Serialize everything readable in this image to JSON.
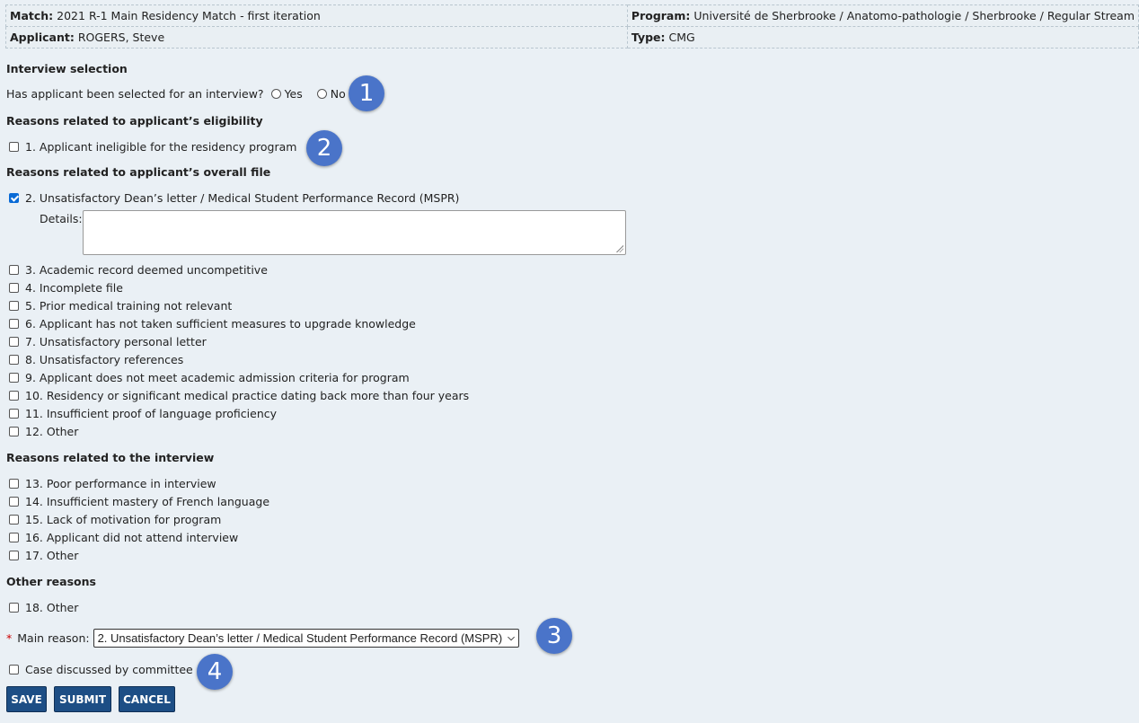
{
  "header": {
    "match_label": "Match:",
    "match_value": "2021 R-1 Main Residency Match - first iteration",
    "program_label": "Program:",
    "program_value": "Université de Sherbrooke / Anatomo-pathologie / Sherbrooke / Regular Stream",
    "applicant_label": "Applicant:",
    "applicant_value": "ROGERS, Steve",
    "type_label": "Type:",
    "type_value": "CMG"
  },
  "interview_selection": {
    "title": "Interview selection",
    "question": "Has applicant been selected for an interview?",
    "yes": "Yes",
    "no": "No"
  },
  "eligibility": {
    "title": "Reasons related to applicant’s eligibility",
    "items": [
      {
        "label": "1. Applicant ineligible for the residency program",
        "checked": false
      }
    ]
  },
  "overall_file": {
    "title": "Reasons related to applicant’s overall file",
    "items": [
      {
        "label": "2. Unsatisfactory Dean’s letter / Medical Student Performance Record (MSPR)",
        "checked": true
      },
      {
        "label": "3. Academic record deemed uncompetitive",
        "checked": false
      },
      {
        "label": "4. Incomplete file",
        "checked": false
      },
      {
        "label": "5. Prior medical training not relevant",
        "checked": false
      },
      {
        "label": "6. Applicant has not taken sufficient measures to upgrade knowledge",
        "checked": false
      },
      {
        "label": "7. Unsatisfactory personal letter",
        "checked": false
      },
      {
        "label": "8. Unsatisfactory references",
        "checked": false
      },
      {
        "label": "9. Applicant does not meet academic admission criteria for program",
        "checked": false
      },
      {
        "label": "10. Residency or significant medical practice dating back more than four years",
        "checked": false
      },
      {
        "label": "11. Insufficient proof of language proficiency",
        "checked": false
      },
      {
        "label": "12. Other",
        "checked": false
      }
    ],
    "details_label": "Details:",
    "details_value": ""
  },
  "interview": {
    "title": "Reasons related to the interview",
    "items": [
      {
        "label": "13. Poor performance in interview",
        "checked": false
      },
      {
        "label": "14. Insufficient mastery of French language",
        "checked": false
      },
      {
        "label": "15. Lack of motivation for program",
        "checked": false
      },
      {
        "label": "16. Applicant did not attend interview",
        "checked": false
      },
      {
        "label": "17. Other",
        "checked": false
      }
    ]
  },
  "other": {
    "title": "Other reasons",
    "items": [
      {
        "label": "18. Other",
        "checked": false
      }
    ]
  },
  "main_reason": {
    "required_mark": "*",
    "label": "Main reason:",
    "selected": "2. Unsatisfactory Dean’s letter / Medical Student Performance Record (MSPR)"
  },
  "committee": {
    "label": "Case discussed by committee",
    "checked": false
  },
  "buttons": {
    "save": "SAVE",
    "submit": "SUBMIT",
    "cancel": "CANCEL"
  },
  "badges": [
    "1",
    "2",
    "3",
    "4"
  ],
  "colors": {
    "badge": "#4a74c9",
    "button": "#1d4e85",
    "checkbox_checked": "#0a6bd6",
    "background": "#eaf0f5"
  }
}
